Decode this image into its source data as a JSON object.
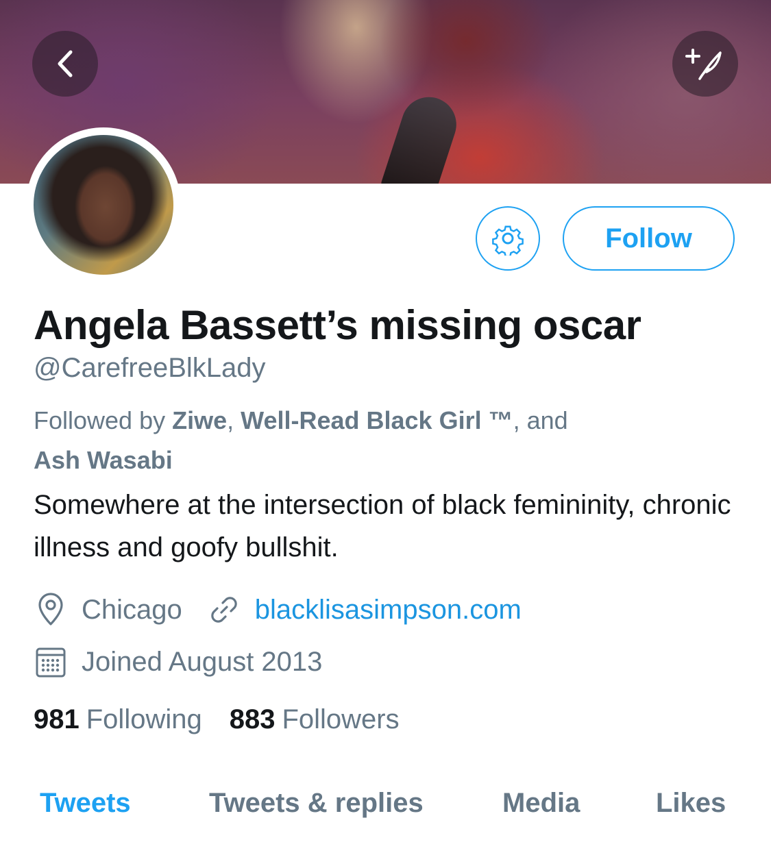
{
  "colors": {
    "accent": "#1da1f2",
    "link": "#1b95e0",
    "secondary_text": "#657786",
    "primary_text": "#14171a"
  },
  "header": {
    "back_icon": "chevron-left-icon",
    "compose_icon": "compose-tweet-icon"
  },
  "profile": {
    "settings_icon": "gear-icon",
    "follow_label": "Follow",
    "display_name": "Angela Bassett’s missing oscar",
    "handle": "@CarefreeBlkLady",
    "followed_by": {
      "prefix": "Followed by ",
      "names": [
        "Ziwe",
        "Well-Read Black Girl ™",
        "Ash Wasabi"
      ],
      "sep1": ", ",
      "sep2": ", and",
      "line2": "Ash Wasabi"
    },
    "bio": "Somewhere at the intersection of black femininity, chronic illness and goofy bullshit.",
    "location": "Chicago",
    "website": "blacklisasimpson.com",
    "joined": "Joined August 2013",
    "following_count": "981",
    "following_label": "Following",
    "followers_count": "883",
    "followers_label": "Followers"
  },
  "tabs": [
    {
      "label": "Tweets",
      "active": true
    },
    {
      "label": "Tweets & replies",
      "active": false
    },
    {
      "label": "Media",
      "active": false
    },
    {
      "label": "Likes",
      "active": false
    }
  ]
}
